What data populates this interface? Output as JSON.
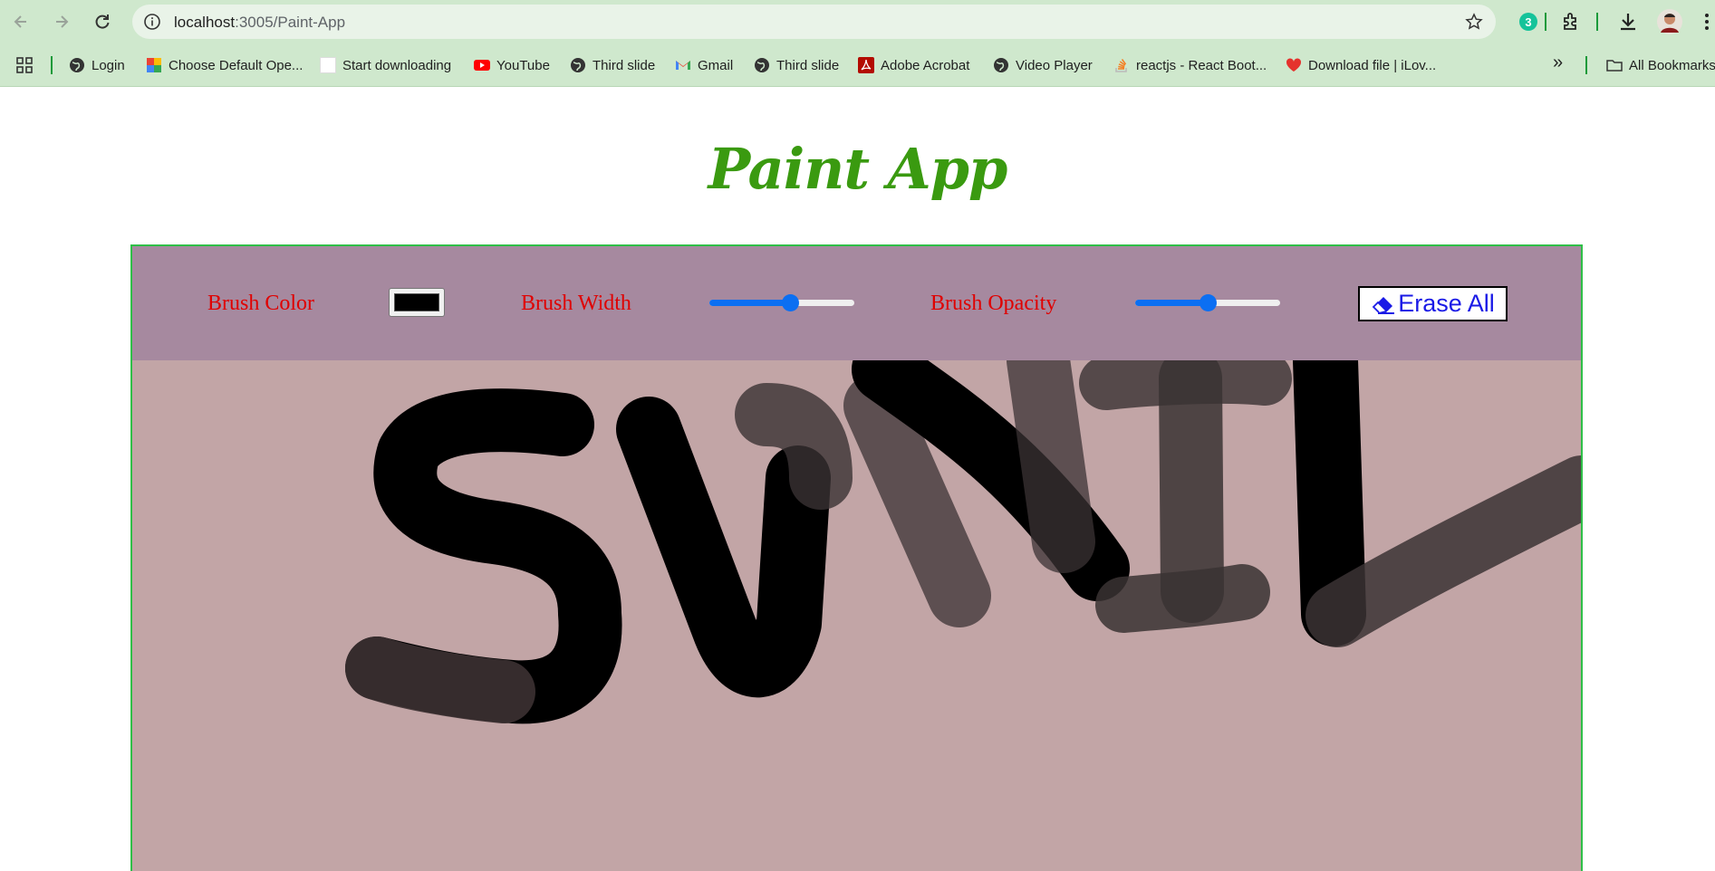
{
  "browser": {
    "url_host": "localhost",
    "url_path": ":3005/Paint-App",
    "extension_badge": "3"
  },
  "bookmarks": {
    "items": [
      {
        "label": "Login",
        "icon": "globe-icon"
      },
      {
        "label": "Choose Default Ope...",
        "icon": "colored-app-icon"
      },
      {
        "label": "Start downloading",
        "icon": "blank-page-icon"
      },
      {
        "label": "YouTube",
        "icon": "youtube-icon"
      },
      {
        "label": "Third slide",
        "icon": "globe-icon"
      },
      {
        "label": "Gmail",
        "icon": "gmail-icon"
      },
      {
        "label": "Third slide",
        "icon": "globe-icon"
      },
      {
        "label": "Adobe Acrobat",
        "icon": "acrobat-icon"
      },
      {
        "label": "Video Player",
        "icon": "globe-icon"
      },
      {
        "label": "reactjs - React Boot...",
        "icon": "stackoverflow-icon"
      },
      {
        "label": "Download file | iLov...",
        "icon": "heart-icon"
      }
    ],
    "overflow": "»",
    "all_bookmarks": "All Bookmarks"
  },
  "app": {
    "title": "Paint App",
    "brush_color_label": "Brush Color",
    "brush_color_value": "#000000",
    "brush_width_label": "Brush Width",
    "brush_width_fraction": 0.57,
    "brush_opacity_label": "Brush Opacity",
    "brush_opacity_fraction": 0.5,
    "erase_label": "Erase All"
  },
  "colors": {
    "title_green": "#3a9a10",
    "label_red": "#e00000",
    "controls_bg": "#a6899f",
    "canvas_bg": "#c2a5a6",
    "frame_border": "#2fbf48",
    "erase_text": "#1a1ae6"
  }
}
